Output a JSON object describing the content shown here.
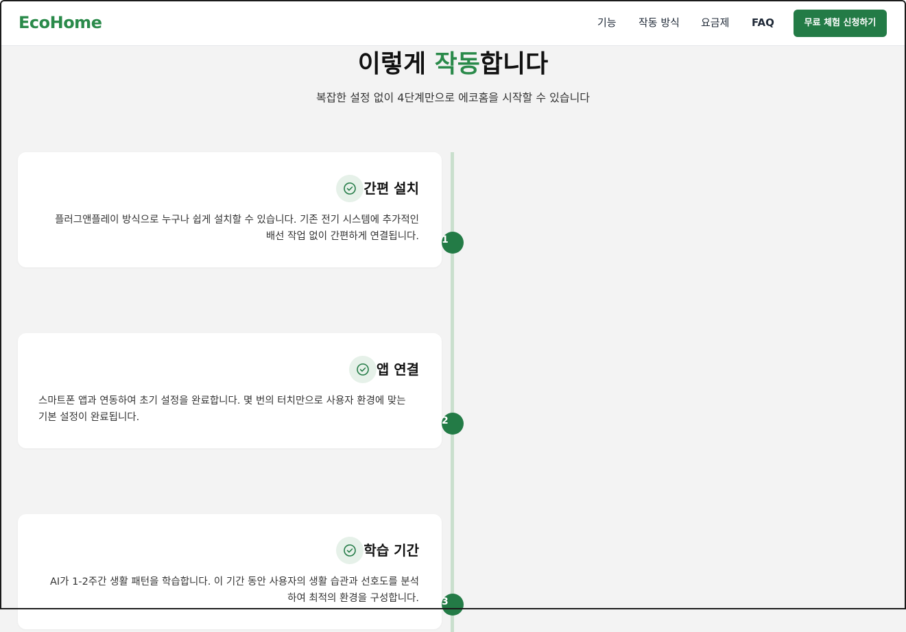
{
  "header": {
    "logo": "EcoHome",
    "nav": [
      "기능",
      "작동 방식",
      "요금제",
      "FAQ"
    ],
    "cta_label": "무료 체험 신청하기"
  },
  "section": {
    "title_before": "이렇게 ",
    "title_accent": "작동",
    "title_after": "합니다",
    "subtitle": "복잡한 설정 없이 4단계만으로 에코홈을 시작할 수 있습니다"
  },
  "steps": [
    {
      "number": "1",
      "title": "간편 설치",
      "desc_line1": "플러그앤플레이 방식으로 누구나 쉽게 설치할 수 있습니다. 기존 전기 시스템에 추가적인",
      "desc_line2": "배선 작업 없이 간편하게 연결됩니다."
    },
    {
      "number": "2",
      "title": "앱 연결",
      "desc_line1": "스마트폰 앱과 연동하여 초기 설정을 완료합니다. 몇 번의 터치만으로 사용자 환경에 맞는",
      "desc_line2": "기본 설정이 완료됩니다."
    },
    {
      "number": "3",
      "title": "학습 기간",
      "desc_line1": "AI가 1-2주간 생활 패턴을 학습합니다. 이 기간 동안 사용자의 생활 습관과 선호도를 분석",
      "desc_line2": "하여 최적의 환경을 구성합니다."
    }
  ],
  "icons": {
    "step_icon": "check-circle-icon"
  },
  "colors": {
    "brand": "#2a8a4a",
    "button": "#237b46",
    "timeline": "#c9dfcd",
    "icon_bg": "#e6f1e9"
  }
}
